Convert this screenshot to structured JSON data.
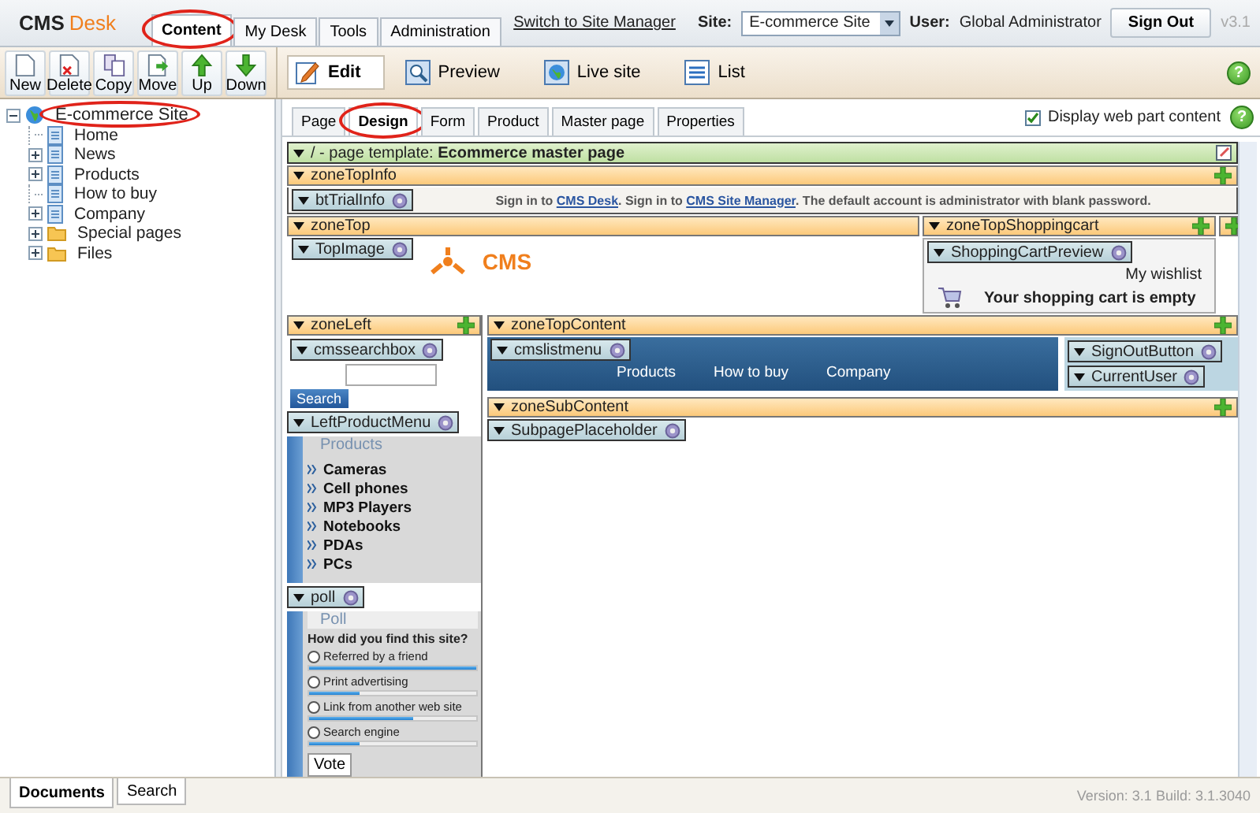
{
  "header": {
    "logo": {
      "first": "CMS",
      "second": "Desk"
    },
    "tabs": [
      {
        "label": "Content",
        "selected": true,
        "annotated": true
      },
      {
        "label": "My Desk",
        "selected": false,
        "annotated": false
      },
      {
        "label": "Tools",
        "selected": false,
        "annotated": false
      },
      {
        "label": "Administration",
        "selected": false,
        "annotated": false
      }
    ],
    "site_manager_link": "Switch to Site Manager",
    "site_label": "Site:",
    "site_value": "E-commerce Site",
    "user_label": "User:",
    "user_name": "Global Administrator",
    "sign_out": "Sign Out",
    "version": "v3.1"
  },
  "toolbar": {
    "actions": [
      {
        "label": "New"
      },
      {
        "label": "Delete"
      },
      {
        "label": "Copy"
      },
      {
        "label": "Move"
      },
      {
        "label": "Up"
      },
      {
        "label": "Down"
      }
    ],
    "views": [
      {
        "label": "Edit",
        "selected": true
      },
      {
        "label": "Preview",
        "selected": false
      },
      {
        "label": "Live site",
        "selected": false
      },
      {
        "label": "List",
        "selected": false
      }
    ],
    "help": "?"
  },
  "tree": {
    "label": "E-commerce Site",
    "kind": "site",
    "expanded": true,
    "annotated": true,
    "children": [
      {
        "label": "Home",
        "kind": "page",
        "has_children": false
      },
      {
        "label": "News",
        "kind": "page",
        "has_children": true
      },
      {
        "label": "Products",
        "kind": "page",
        "has_children": true
      },
      {
        "label": "How to buy",
        "kind": "page",
        "has_children": false
      },
      {
        "label": "Company",
        "kind": "page",
        "has_children": true
      },
      {
        "label": "Special pages",
        "kind": "folder",
        "has_children": true
      },
      {
        "label": "Files",
        "kind": "folder",
        "has_children": true
      }
    ]
  },
  "page_tabs": [
    {
      "label": "Page",
      "selected": false,
      "annotated": false
    },
    {
      "label": "Design",
      "selected": true,
      "annotated": true
    },
    {
      "label": "Form",
      "selected": false,
      "annotated": false
    },
    {
      "label": "Product",
      "selected": false,
      "annotated": false
    },
    {
      "label": "Master page",
      "selected": false,
      "annotated": false
    },
    {
      "label": "Properties",
      "selected": false,
      "annotated": false
    }
  ],
  "display_web_part_content": {
    "label": "Display web part content",
    "checked": true
  },
  "page_help": "?",
  "design": {
    "template_bar": "/ - page template: **Ecommerce master page**",
    "zone_top_info": {
      "title": "zoneTopInfo",
      "webpart": "btTrialInfo",
      "sentence": [
        {
          "kind": "text",
          "text": "Sign in to "
        },
        {
          "kind": "link",
          "text": "CMS Desk"
        },
        {
          "kind": "text",
          "text": ". Sign in to "
        },
        {
          "kind": "link",
          "text": "CMS Site Manager"
        },
        {
          "kind": "text",
          "text": ". The default account is administrator with blank password."
        }
      ]
    },
    "zone_top": {
      "title": "zoneTop",
      "webpart": "TopImage",
      "logo_text": "CMS"
    },
    "zone_top_cart": {
      "title": "zoneTopShoppingcart",
      "webpart": "ShoppingCartPreview",
      "links": "My wishlist",
      "message": "Your shopping cart is empty"
    },
    "zone_left": {
      "title": "zoneLeft",
      "search_webpart": "cmssearchbox",
      "search_button": "Search",
      "menu_webpart": "LeftProductMenu",
      "menu_title": "Products",
      "menu_items": [
        "Cameras",
        "Cell phones",
        "MP3 Players",
        "Notebooks",
        "PDAs",
        "PCs"
      ],
      "poll_webpart": "poll",
      "poll_title": "Poll",
      "question": "How did you find this site?",
      "answers": [
        {
          "label": "Referred by a friend",
          "selected": false,
          "level": 1
        },
        {
          "label": "Print advertising",
          "selected": false,
          "level": 0.3
        },
        {
          "label": "Link from another web site",
          "selected": false,
          "level": 0.62
        },
        {
          "label": "Search engine",
          "selected": false,
          "level": 0.3
        }
      ],
      "vote": "Vote"
    },
    "zone_top_content": {
      "title": "zoneTopContent",
      "webpart": "cmslistmenu",
      "menu": [
        "Products",
        "How to buy",
        "Company"
      ],
      "side_webparts": [
        "SignOutButton",
        "CurrentUser"
      ]
    },
    "zone_sub_content": {
      "title": "zoneSubContent",
      "webpart": "SubpagePlaceholder"
    }
  },
  "bottom": {
    "tabs": [
      {
        "label": "Documents",
        "selected": true
      },
      {
        "label": "Search",
        "selected": false
      }
    ],
    "version": "Version: 3.1 Build: 3.1.3040"
  }
}
